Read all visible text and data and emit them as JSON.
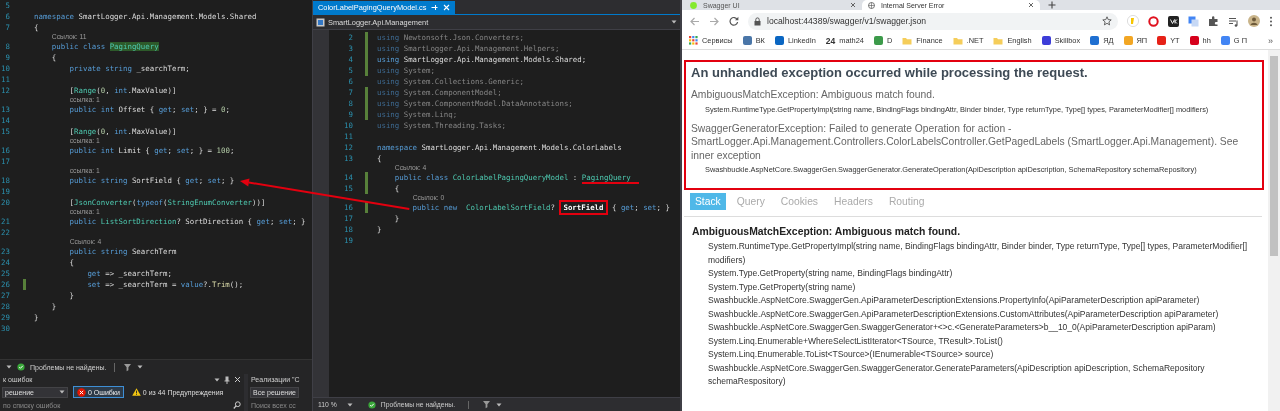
{
  "left_editor": {
    "lines": [
      {
        "number": "5",
        "changed": false
      },
      {
        "number": "6",
        "changed": false,
        "tokens": [
          {
            "kind": "keyword",
            "text": "namespace "
          },
          {
            "kind": "text",
            "text": "SmartLogger.Api.Management.Models.Shared"
          }
        ]
      },
      {
        "number": "7",
        "changed": false,
        "tokens": [
          {
            "kind": "text",
            "text": "{"
          }
        ]
      },
      {
        "number": "8",
        "changed": false,
        "lens": "Ссылок: 11",
        "tokens": [
          {
            "kind": "keyword",
            "text": "    public "
          },
          {
            "kind": "keyword",
            "text": "class "
          },
          {
            "kind": "match",
            "text": "PagingQuery"
          }
        ]
      },
      {
        "number": "9",
        "changed": false,
        "tokens": [
          {
            "kind": "text",
            "text": "    {"
          }
        ]
      },
      {
        "number": "10",
        "changed": false,
        "tokens": [
          {
            "kind": "keyword",
            "text": "        private "
          },
          {
            "kind": "keyword",
            "text": "string "
          },
          {
            "kind": "text",
            "text": "_searchTerm;"
          }
        ]
      },
      {
        "number": "11",
        "changed": false
      },
      {
        "number": "12",
        "changed": false,
        "tokens": [
          {
            "kind": "text",
            "text": "        ["
          },
          {
            "kind": "type",
            "text": "Range"
          },
          {
            "kind": "text",
            "text": "("
          },
          {
            "kind": "number",
            "text": "0"
          },
          {
            "kind": "text",
            "text": ", "
          },
          {
            "kind": "keyword",
            "text": "int"
          },
          {
            "kind": "text",
            "text": ".MaxValue)]"
          }
        ]
      },
      {
        "number": "13",
        "changed": false,
        "lens": "ссылка: 1",
        "tokens": [
          {
            "kind": "keyword",
            "text": "        public "
          },
          {
            "kind": "keyword",
            "text": "int "
          },
          {
            "kind": "text",
            "text": "Offset { "
          },
          {
            "kind": "keyword",
            "text": "get"
          },
          {
            "kind": "text",
            "text": "; "
          },
          {
            "kind": "keyword",
            "text": "set"
          },
          {
            "kind": "text",
            "text": "; } = "
          },
          {
            "kind": "number",
            "text": "0"
          },
          {
            "kind": "text",
            "text": ";"
          }
        ]
      },
      {
        "number": "14",
        "changed": false
      },
      {
        "number": "15",
        "changed": false,
        "tokens": [
          {
            "kind": "text",
            "text": "        ["
          },
          {
            "kind": "type",
            "text": "Range"
          },
          {
            "kind": "text",
            "text": "("
          },
          {
            "kind": "number",
            "text": "0"
          },
          {
            "kind": "text",
            "text": ", "
          },
          {
            "kind": "keyword",
            "text": "int"
          },
          {
            "kind": "text",
            "text": ".MaxValue)]"
          }
        ]
      },
      {
        "number": "16",
        "changed": false,
        "lens": "ссылка: 1",
        "tokens": [
          {
            "kind": "keyword",
            "text": "        public "
          },
          {
            "kind": "keyword",
            "text": "int "
          },
          {
            "kind": "text",
            "text": "Limit { "
          },
          {
            "kind": "keyword",
            "text": "get"
          },
          {
            "kind": "text",
            "text": "; "
          },
          {
            "kind": "keyword",
            "text": "set"
          },
          {
            "kind": "text",
            "text": "; } = "
          },
          {
            "kind": "number",
            "text": "100"
          },
          {
            "kind": "text",
            "text": ";"
          }
        ]
      },
      {
        "number": "17",
        "changed": false
      },
      {
        "number": "18",
        "changed": false,
        "lens": "ссылка: 1",
        "tokens": [
          {
            "kind": "keyword",
            "text": "        public "
          },
          {
            "kind": "keyword",
            "text": "string "
          },
          {
            "kind": "text",
            "text": "SortField { "
          },
          {
            "kind": "keyword",
            "text": "get"
          },
          {
            "kind": "text",
            "text": "; "
          },
          {
            "kind": "keyword",
            "text": "set"
          },
          {
            "kind": "text",
            "text": "; "
          },
          {
            "kind": "arrow-end-text",
            "text": "}"
          }
        ]
      },
      {
        "number": "19",
        "changed": false
      },
      {
        "number": "20",
        "changed": false,
        "tokens": [
          {
            "kind": "text",
            "text": "        ["
          },
          {
            "kind": "type",
            "text": "JsonConverter"
          },
          {
            "kind": "text",
            "text": "("
          },
          {
            "kind": "keyword",
            "text": "typeof"
          },
          {
            "kind": "text",
            "text": "("
          },
          {
            "kind": "type",
            "text": "StringEnumConverter"
          },
          {
            "kind": "text",
            "text": "))]"
          }
        ]
      },
      {
        "number": "21",
        "changed": false,
        "lens": "ссылка: 1",
        "tokens": [
          {
            "kind": "keyword",
            "text": "        public "
          },
          {
            "kind": "type",
            "text": "ListSortDirection"
          },
          {
            "kind": "text",
            "text": "? SortDirection { "
          },
          {
            "kind": "keyword",
            "text": "get"
          },
          {
            "kind": "text",
            "text": "; "
          },
          {
            "kind": "keyword",
            "text": "set"
          },
          {
            "kind": "text",
            "text": "; }"
          }
        ]
      },
      {
        "number": "22",
        "changed": false
      },
      {
        "number": "23",
        "changed": false,
        "lens": "Ссылок: 4",
        "tokens": [
          {
            "kind": "keyword",
            "text": "        public "
          },
          {
            "kind": "keyword",
            "text": "string "
          },
          {
            "kind": "text",
            "text": "SearchTerm"
          }
        ]
      },
      {
        "number": "24",
        "changed": false,
        "tokens": [
          {
            "kind": "text",
            "text": "        {"
          }
        ]
      },
      {
        "number": "25",
        "changed": false,
        "tokens": [
          {
            "kind": "keyword",
            "text": "            get"
          },
          {
            "kind": "text",
            "text": " => _searchTerm;"
          }
        ]
      },
      {
        "number": "26",
        "changed": true,
        "tokens": [
          {
            "kind": "keyword",
            "text": "            set"
          },
          {
            "kind": "text",
            "text": " => _searchTerm = "
          },
          {
            "kind": "keyword",
            "text": "value"
          },
          {
            "kind": "text",
            "text": "?."
          },
          {
            "kind": "method",
            "text": "Trim"
          },
          {
            "kind": "text",
            "text": "();"
          }
        ]
      },
      {
        "number": "27",
        "changed": false,
        "tokens": [
          {
            "kind": "text",
            "text": "        }"
          }
        ]
      },
      {
        "number": "28",
        "changed": false,
        "tokens": [
          {
            "kind": "text",
            "text": "    }"
          }
        ]
      },
      {
        "number": "29",
        "changed": false,
        "tokens": [
          {
            "kind": "text",
            "text": "}"
          }
        ]
      },
      {
        "number": "30",
        "changed": false
      }
    ],
    "status": {
      "message": "Проблемы не найдены."
    },
    "error_list": {
      "title": "к ошибок",
      "scope": "решение",
      "errors": "0 Ошибки",
      "warnings": "0 из 44 Предупреждения",
      "search_placeholder": "по списку ошибок"
    },
    "references_panel": {
      "title": "Реализации \"С",
      "scope": "Все решение",
      "search_placeholder": "Поиск всех сс"
    }
  },
  "middle_editor": {
    "tab": {
      "title": "ColorLabelPagingQueryModel.cs"
    },
    "project": "SmartLogger.Api.Management",
    "lines": [
      {
        "number": "2",
        "changed": true,
        "tokens": [
          {
            "kind": "dim-keyword",
            "text": "using "
          },
          {
            "kind": "dim",
            "text": "Newtonsoft.Json.Converters;"
          }
        ]
      },
      {
        "number": "3",
        "changed": true,
        "tokens": [
          {
            "kind": "dim-keyword",
            "text": "using "
          },
          {
            "kind": "dim",
            "text": "SmartLogger.Api.Management.Helpers;"
          }
        ]
      },
      {
        "number": "4",
        "changed": true,
        "tokens": [
          {
            "kind": "keyword",
            "text": "using "
          },
          {
            "kind": "text",
            "text": "SmartLogger.Api.Management.Models.Shared;"
          }
        ]
      },
      {
        "number": "5",
        "changed": true,
        "tokens": [
          {
            "kind": "dim-keyword",
            "text": "using "
          },
          {
            "kind": "dim",
            "text": "System;"
          }
        ]
      },
      {
        "number": "6",
        "changed": false,
        "tokens": [
          {
            "kind": "dim-keyword",
            "text": "using "
          },
          {
            "kind": "dim",
            "text": "System.Collections.Generic;"
          }
        ]
      },
      {
        "number": "7",
        "changed": true,
        "tokens": [
          {
            "kind": "dim-keyword",
            "text": "using "
          },
          {
            "kind": "dim",
            "text": "System.ComponentModel;"
          }
        ]
      },
      {
        "number": "8",
        "changed": true,
        "tokens": [
          {
            "kind": "dim-keyword",
            "text": "using "
          },
          {
            "kind": "dim",
            "text": "System.ComponentModel.DataAnnotations;"
          }
        ]
      },
      {
        "number": "9",
        "changed": true,
        "tokens": [
          {
            "kind": "dim-keyword",
            "text": "using "
          },
          {
            "kind": "dim",
            "text": "System.Linq;"
          }
        ]
      },
      {
        "number": "10",
        "changed": false,
        "tokens": [
          {
            "kind": "dim-keyword",
            "text": "using "
          },
          {
            "kind": "dim",
            "text": "System.Threading.Tasks;"
          }
        ]
      },
      {
        "number": "11",
        "changed": false
      },
      {
        "number": "12",
        "changed": false,
        "tokens": [
          {
            "kind": "keyword",
            "text": "namespace "
          },
          {
            "kind": "text",
            "text": "SmartLogger.Api.Management.Models.ColorLabels"
          }
        ]
      },
      {
        "number": "13",
        "changed": false,
        "tokens": [
          {
            "kind": "text",
            "text": "{"
          }
        ]
      },
      {
        "number": "14",
        "changed": true,
        "lens": "Ссылок: 4",
        "tokens": [
          {
            "kind": "keyword",
            "text": "    public "
          },
          {
            "kind": "keyword",
            "text": "class "
          },
          {
            "kind": "type",
            "text": "ColorLabelPagingQueryModel"
          },
          {
            "kind": "text",
            "text": " : "
          },
          {
            "kind": "underlined-type",
            "text": "PagingQuery"
          }
        ]
      },
      {
        "number": "15",
        "changed": true,
        "tokens": [
          {
            "kind": "text",
            "text": "    {"
          }
        ]
      },
      {
        "number": "16",
        "changed": true,
        "lens": "Ссылок: 0",
        "tokens": [
          {
            "kind": "arrow-start-keyword",
            "text": "        public "
          },
          {
            "kind": "keyword",
            "text": "new  "
          },
          {
            "kind": "type",
            "text": "ColorLabelSortField"
          },
          {
            "kind": "text",
            "text": "? "
          },
          {
            "kind": "boxed-text",
            "text": "SortField"
          },
          {
            "kind": "text",
            "text": " { "
          },
          {
            "kind": "keyword",
            "text": "get"
          },
          {
            "kind": "text",
            "text": "; "
          },
          {
            "kind": "keyword",
            "text": "set"
          },
          {
            "kind": "text",
            "text": "; }"
          }
        ]
      },
      {
        "number": "17",
        "changed": false,
        "tokens": [
          {
            "kind": "text",
            "text": "    }"
          }
        ]
      },
      {
        "number": "18",
        "changed": false,
        "tokens": [
          {
            "kind": "text",
            "text": "}"
          }
        ]
      },
      {
        "number": "19",
        "changed": false
      }
    ],
    "zoom": "110 %",
    "status": {
      "message": "Проблемы не найдены."
    }
  },
  "browser": {
    "tabs": [
      {
        "title": "Swagger UI",
        "selected": false
      },
      {
        "title": "Internal Server Error",
        "selected": true
      }
    ],
    "address": "localhost:44389/swagger/v1/swagger.json",
    "bookmarks": [
      {
        "label": "Сервисы",
        "kind": "apps"
      },
      {
        "label": "ВК",
        "kind": "favicon",
        "color": "#4a76a8"
      },
      {
        "label": "LinkedIn",
        "kind": "favicon",
        "color": "#0a66c2"
      },
      {
        "label": "math24",
        "kind": "badge",
        "badge": "24"
      },
      {
        "label": "D",
        "kind": "favicon",
        "color": "#3c9a4a"
      },
      {
        "label": "Finance",
        "kind": "folder"
      },
      {
        "label": ".NET",
        "kind": "folder"
      },
      {
        "label": "English",
        "kind": "folder"
      },
      {
        "label": "Skillbox",
        "kind": "favicon",
        "color": "#3d3dd8"
      },
      {
        "label": "ЯД",
        "kind": "favicon",
        "color": "#1f6fd1"
      },
      {
        "label": "ЯП",
        "kind": "favicon",
        "color": "#f2a623"
      },
      {
        "label": "YT",
        "kind": "favicon",
        "color": "#e62117"
      },
      {
        "label": "hh",
        "kind": "favicon",
        "color": "#d6001c"
      },
      {
        "label": "G П",
        "kind": "favicon",
        "color": "#4285f4"
      }
    ],
    "bookmarks_overflow": "»",
    "error": {
      "title": "An unhandled exception occurred while processing the request.",
      "annotated": true,
      "exceptions": [
        {
          "message": "AmbiguousMatchException: Ambiguous match found.",
          "location": "System.RuntimeType.GetPropertyImpl(string name, BindingFlags bindingAttr, Binder binder, Type returnType, Type[] types, ParameterModifier[] modifiers)"
        },
        {
          "message": "SwaggerGeneratorException: Failed to generate Operation for action - SmartLogger.Api.Management.Controllers.ColorLabelsController.GetPagedLabels (SmartLogger.Api.Management). See inner exception",
          "location": "Swashbuckle.AspNetCore.SwaggerGen.SwaggerGenerator.GenerateOperation(ApiDescription apiDescription, SchemaRepository schemaRepository)"
        }
      ]
    },
    "detail_tabs": [
      {
        "label": "Stack",
        "selected": true
      },
      {
        "label": "Query",
        "selected": false
      },
      {
        "label": "Cookies",
        "selected": false
      },
      {
        "label": "Headers",
        "selected": false
      },
      {
        "label": "Routing",
        "selected": false
      }
    ],
    "stack": {
      "title": "AmbiguousMatchException: Ambiguous match found.",
      "frames": [
        "System.RuntimeType.GetPropertyImpl(string name, BindingFlags bindingAttr, Binder binder, Type returnType, Type[] types, ParameterModifier[] modifiers)",
        "System.Type.GetProperty(string name, BindingFlags bindingAttr)",
        "System.Type.GetProperty(string name)",
        "Swashbuckle.AspNetCore.SwaggerGen.ApiParameterDescriptionExtensions.PropertyInfo(ApiParameterDescription apiParameter)",
        "Swashbuckle.AspNetCore.SwaggerGen.ApiParameterDescriptionExtensions.CustomAttributes(ApiParameterDescription apiParameter)",
        "Swashbuckle.AspNetCore.SwaggerGen.SwaggerGenerator+<>c.<GenerateParameters>b__10_0(ApiParameterDescription apiParam)",
        "System.Linq.Enumerable+WhereSelectListIterator<TSource, TResult>.ToList()",
        "System.Linq.Enumerable.ToList<TSource>(IEnumerable<TSource> source)",
        "Swashbuckle.AspNetCore.SwaggerGen.SwaggerGenerator.GenerateParameters(ApiDescription apiDescription, SchemaRepository schemaRespository)"
      ]
    }
  }
}
